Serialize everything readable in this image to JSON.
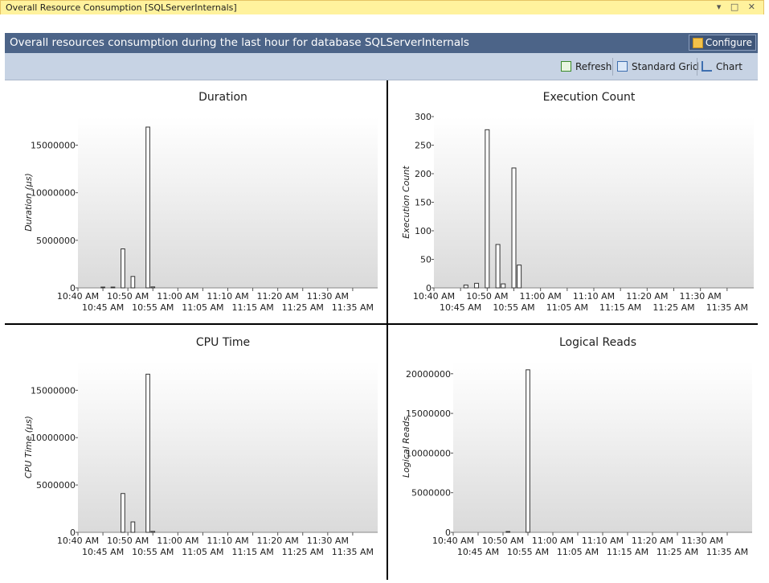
{
  "window": {
    "title": "Overall Resource Consumption [SQLServerInternals]",
    "controls": "▾ □ ✕"
  },
  "banner": {
    "text": "Overall resources consumption during the last hour for database SQLServerInternals",
    "configure_label": "Configure"
  },
  "toolbar": {
    "refresh_label": "Refresh",
    "grid_label": "Standard Grid",
    "chart_label": "Chart"
  },
  "colors": {
    "banner": "#4c6488",
    "toolbar": "#c7d3e4",
    "title_bar": "#fff29d",
    "bar_fill": "#ffffff",
    "bar_stroke": "#333333"
  },
  "chart_data": [
    {
      "type": "bar",
      "title": "Duration",
      "ylabel": "Duration (µs)",
      "ylim": [
        0,
        18000000
      ],
      "yticks": [
        0,
        5000000,
        10000000,
        15000000
      ],
      "xticks_top": [
        "10:40 AM",
        "10:50 AM",
        "11:00 AM",
        "11:10 AM",
        "11:20 AM",
        "11:30 AM"
      ],
      "xticks_bottom": [
        "10:45 AM",
        "10:55 AM",
        "11:05 AM",
        "11:15 AM",
        "11:25 AM",
        "11:35 AM"
      ],
      "x": [
        "10:45",
        "10:47",
        "10:49",
        "10:51",
        "10:54",
        "10:55"
      ],
      "values": [
        60000,
        70000,
        4100000,
        1200000,
        16900000,
        100000
      ]
    },
    {
      "type": "bar",
      "title": "Execution Count",
      "ylabel": "Execution Count",
      "ylim": [
        0,
        300
      ],
      "yticks": [
        0,
        50,
        100,
        150,
        200,
        250,
        300
      ],
      "xticks_top": [
        "10:40 AM",
        "10:50 AM",
        "11:00 AM",
        "11:10 AM",
        "11:20 AM",
        "11:30 AM"
      ],
      "xticks_bottom": [
        "10:45 AM",
        "10:55 AM",
        "11:05 AM",
        "11:15 AM",
        "11:25 AM",
        "11:35 AM"
      ],
      "x": [
        "10:46",
        "10:48",
        "10:50",
        "10:52",
        "10:53",
        "10:55",
        "10:56"
      ],
      "values": [
        5,
        8,
        277,
        76,
        7,
        210,
        40
      ]
    },
    {
      "type": "bar",
      "title": "CPU Time",
      "ylabel": "CPU Time (µs)",
      "ylim": [
        0,
        18000000
      ],
      "yticks": [
        0,
        5000000,
        10000000,
        15000000
      ],
      "xticks_top": [
        "10:40 AM",
        "10:50 AM",
        "11:00 AM",
        "11:10 AM",
        "11:20 AM",
        "11:30 AM"
      ],
      "xticks_bottom": [
        "10:45 AM",
        "10:55 AM",
        "11:05 AM",
        "11:15 AM",
        "11:25 AM",
        "11:35 AM"
      ],
      "x": [
        "10:49",
        "10:51",
        "10:54",
        "10:55"
      ],
      "values": [
        4100000,
        1100000,
        16700000,
        100000
      ]
    },
    {
      "type": "bar",
      "title": "Logical Reads",
      "ylabel": "Logical Reads",
      "ylim": [
        0,
        21500000
      ],
      "yticks": [
        0,
        5000000,
        10000000,
        15000000,
        20000000
      ],
      "xticks_top": [
        "10:40 AM",
        "10:50 AM",
        "11:00 AM",
        "11:10 AM",
        "11:20 AM",
        "11:30 AM"
      ],
      "xticks_bottom": [
        "10:45 AM",
        "10:55 AM",
        "11:05 AM",
        "11:15 AM",
        "11:25 AM",
        "11:35 AM"
      ],
      "x": [
        "10:51",
        "10:55"
      ],
      "values": [
        60000,
        20500000
      ]
    }
  ]
}
